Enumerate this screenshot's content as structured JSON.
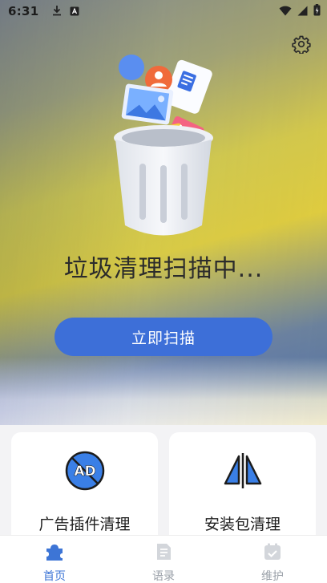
{
  "status_bar": {
    "time": "6:31",
    "left_icons": [
      "download-icon",
      "app-notification-icon"
    ],
    "right_icons": [
      "wifi-icon",
      "signal-icon",
      "battery-icon"
    ]
  },
  "header": {
    "settings_icon": "gear-icon"
  },
  "hero": {
    "illustration": "trash-can-with-files-illustration",
    "title": "垃圾清理扫描中...",
    "scan_button_label": "立即扫描"
  },
  "cards": [
    {
      "label": "广告插件清理",
      "icon": "ad-block-icon"
    },
    {
      "label": "安装包清理",
      "icon": "apk-split-icon"
    }
  ],
  "tabbar": {
    "tabs": [
      {
        "label": "首页",
        "icon": "home-puzzle-icon",
        "active": true
      },
      {
        "label": "语录",
        "icon": "document-icon",
        "active": false
      },
      {
        "label": "维护",
        "icon": "clipboard-check-icon",
        "active": false
      }
    ]
  },
  "colors": {
    "primary": "#3d6fd8",
    "tab_active": "#3d75d6",
    "tab_inactive": "#9aa0a8"
  }
}
